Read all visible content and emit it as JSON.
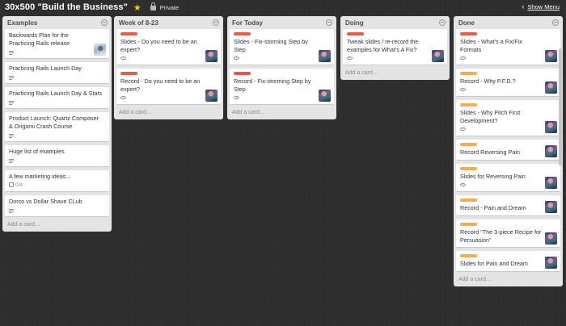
{
  "board": {
    "title": "30x500 \"Build the Business\"",
    "star_icon": "star-icon",
    "privacy": "Private",
    "show_menu": "Show Menu"
  },
  "colors": {
    "background": "#2e2e2e",
    "list_bg": "#e2e4e6",
    "label_red": "#eb5a46",
    "label_orange": "#ffab4a",
    "star": "#f2d600"
  },
  "add_card_label": "Add a card…",
  "lists": [
    {
      "title": "Examples",
      "cards": [
        {
          "title": "Backwards Plan for the Practicing Rails release",
          "label": null,
          "badge": "description",
          "avatar": "light"
        },
        {
          "title": "Practicing Rails Launch Day",
          "label": null,
          "badge": "description",
          "avatar": null
        },
        {
          "title": "Practicing Rails Launch Day & Stats",
          "label": null,
          "badge": "description",
          "avatar": null
        },
        {
          "title": "Product Launch: Quartz Composer & Origami Crash Course",
          "label": null,
          "badge": "description",
          "avatar": null
        },
        {
          "title": "Huge list of examples",
          "label": null,
          "badge": "description",
          "avatar": null
        },
        {
          "title": "A few marketing ideas...",
          "label": null,
          "badge": "checklist",
          "checklist": "0/4",
          "avatar": null
        },
        {
          "title": "Dorco vs Dollar Shave CLub",
          "label": null,
          "badge": "description",
          "avatar": null
        }
      ]
    },
    {
      "title": "Week of 8-23",
      "cards": [
        {
          "title": "Slides - Do you need to be an expert?",
          "label": "red",
          "badge": "watch",
          "avatar": "dark"
        },
        {
          "title": "Record - Do you need to be an expert?",
          "label": "red",
          "badge": "watch",
          "avatar": "dark"
        }
      ]
    },
    {
      "title": "For Today",
      "cards": [
        {
          "title": "Slides - Fix-storming Step by Step",
          "label": "red",
          "badge": "watch",
          "avatar": "dark"
        },
        {
          "title": "Record - Fix-storming Step by Step",
          "label": "red",
          "badge": "watch",
          "avatar": "dark"
        }
      ]
    },
    {
      "title": "Doing",
      "cards": [
        {
          "title": "Tweak slides / re-record the examples for What's A Fix?",
          "label": "red",
          "badge": "watch",
          "avatar": "dark"
        }
      ]
    },
    {
      "title": "Done",
      "cards": [
        {
          "title": "Slides - What's a Fix/Fix Formats",
          "label": "red",
          "badge": "watch",
          "avatar": "dark"
        },
        {
          "title": "Record - Why P.F.D.?",
          "label": "orange",
          "badge": "watch",
          "avatar": "dark"
        },
        {
          "title": "Slides - Why Pitch First Development?",
          "label": "orange",
          "badge": "watch",
          "avatar": "dark"
        },
        {
          "title": "Record Reversing Pain",
          "label": "orange",
          "badge": null,
          "avatar": "dark"
        },
        {
          "title": "Slides for Reversing Pain",
          "label": "orange",
          "badge": "watch",
          "avatar": "dark"
        },
        {
          "title": "Record - Pain and Dream",
          "label": "orange",
          "badge": null,
          "avatar": "dark"
        },
        {
          "title": "Record \"The 3-piece Recipe for Persuasion\"",
          "label": "orange",
          "badge": null,
          "avatar": "dark"
        },
        {
          "title": "Slides for Pain and Dream",
          "label": "orange",
          "badge": null,
          "avatar": "dark"
        }
      ]
    }
  ]
}
